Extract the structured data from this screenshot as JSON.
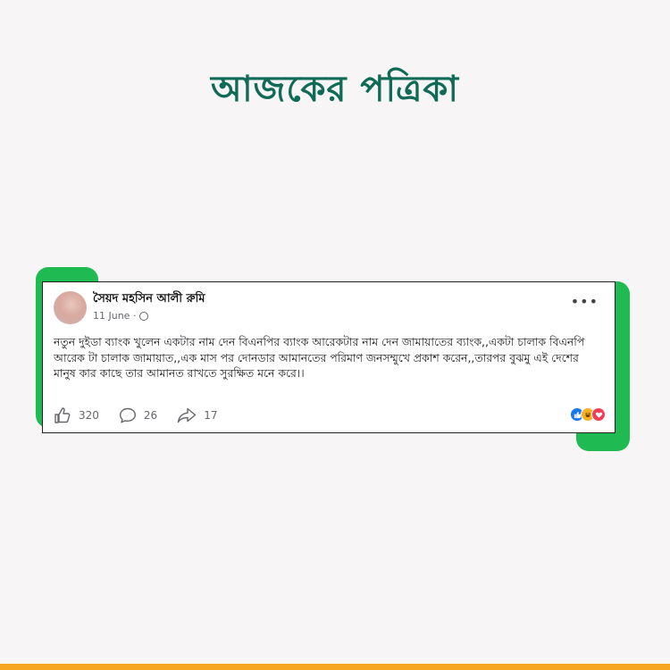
{
  "brand": {
    "title": "আজকের পত্রিকা"
  },
  "post": {
    "author": "সৈয়দ মহসিন আলী রুমি",
    "date": "11 June ·",
    "body": "নতুন দুইডা ব্যাংক খুলেন একটার নাম দেন বিএনপির ব্যাংক আরেকটার নাম দেন জামায়াতের ব্যাংক,,একটা চালাক বিএনপি আরেক টা চালাক জামায়াত,,এক মাস পর দোনডার আমানতের পরিমাণ জনসম্মুখে প্রকাশ করেন,,তারপর বুঝমু এই দেশের মানুষ কার কাছে তার আমানত রাখতে সুরক্ষিত মনে করে।।",
    "more_icon": "more-horizontal-icon",
    "likes": "320",
    "comments": "26",
    "shares": "17",
    "reactions": [
      "like-icon",
      "haha-icon",
      "love-icon"
    ]
  },
  "colors": {
    "brand": "#0f6b55",
    "accent": "#1fba52",
    "strip": "#f6a623",
    "like": "#1877f2",
    "love": "#f33e58",
    "haha": "#f7b125"
  }
}
